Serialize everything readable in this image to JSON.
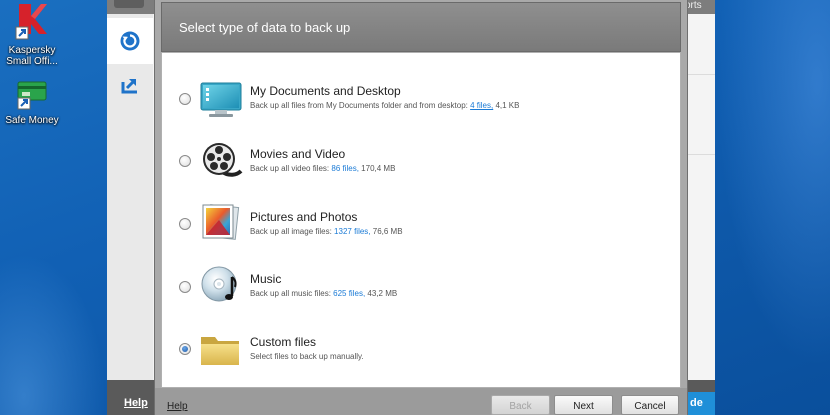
{
  "desktop": {
    "icons": [
      {
        "label": "Kaspersky Small Offi...",
        "icon": "kaspersky-icon"
      },
      {
        "label": "Safe Money",
        "icon": "safe-money-icon"
      }
    ]
  },
  "main_window": {
    "top_right_fragment": "orts",
    "sidebar": [
      {
        "icon": "backup-restore-icon",
        "active": true
      },
      {
        "icon": "upload-arrow-icon",
        "active": false
      }
    ],
    "help_label": "Help",
    "right_button_fragment": "de",
    "accent": "#1f8fd8"
  },
  "dialog": {
    "title": "Select type of data to back up",
    "options": [
      {
        "title": "My Documents and Desktop",
        "desc_prefix": "Back up all files from My Documents folder and from desktop: ",
        "link": "4 files,",
        "desc_suffix": " 4,1 KB",
        "icon": "documents-desktop-icon",
        "selected": false
      },
      {
        "title": "Movies and Video",
        "desc_prefix": "Back up all video files: ",
        "link": "86 files,",
        "desc_suffix": " 170,4 MB",
        "icon": "film-reel-icon",
        "selected": false
      },
      {
        "title": "Pictures and Photos",
        "desc_prefix": "Back up all image files: ",
        "link": "1327 files,",
        "desc_suffix": " 76,6 MB",
        "icon": "pictures-icon",
        "selected": false
      },
      {
        "title": "Music",
        "desc_prefix": "Back up all music files: ",
        "link": "625 files,",
        "desc_suffix": " 43,2 MB",
        "icon": "music-cd-icon",
        "selected": false
      },
      {
        "title": "Custom files",
        "desc_prefix": "Select files to back up manually.",
        "link": "",
        "desc_suffix": "",
        "icon": "folder-icon",
        "selected": true
      }
    ],
    "help_label": "Help",
    "buttons": {
      "back": "Back",
      "next": "Next",
      "cancel": "Cancel"
    },
    "link_color": "#1b7bd6"
  }
}
